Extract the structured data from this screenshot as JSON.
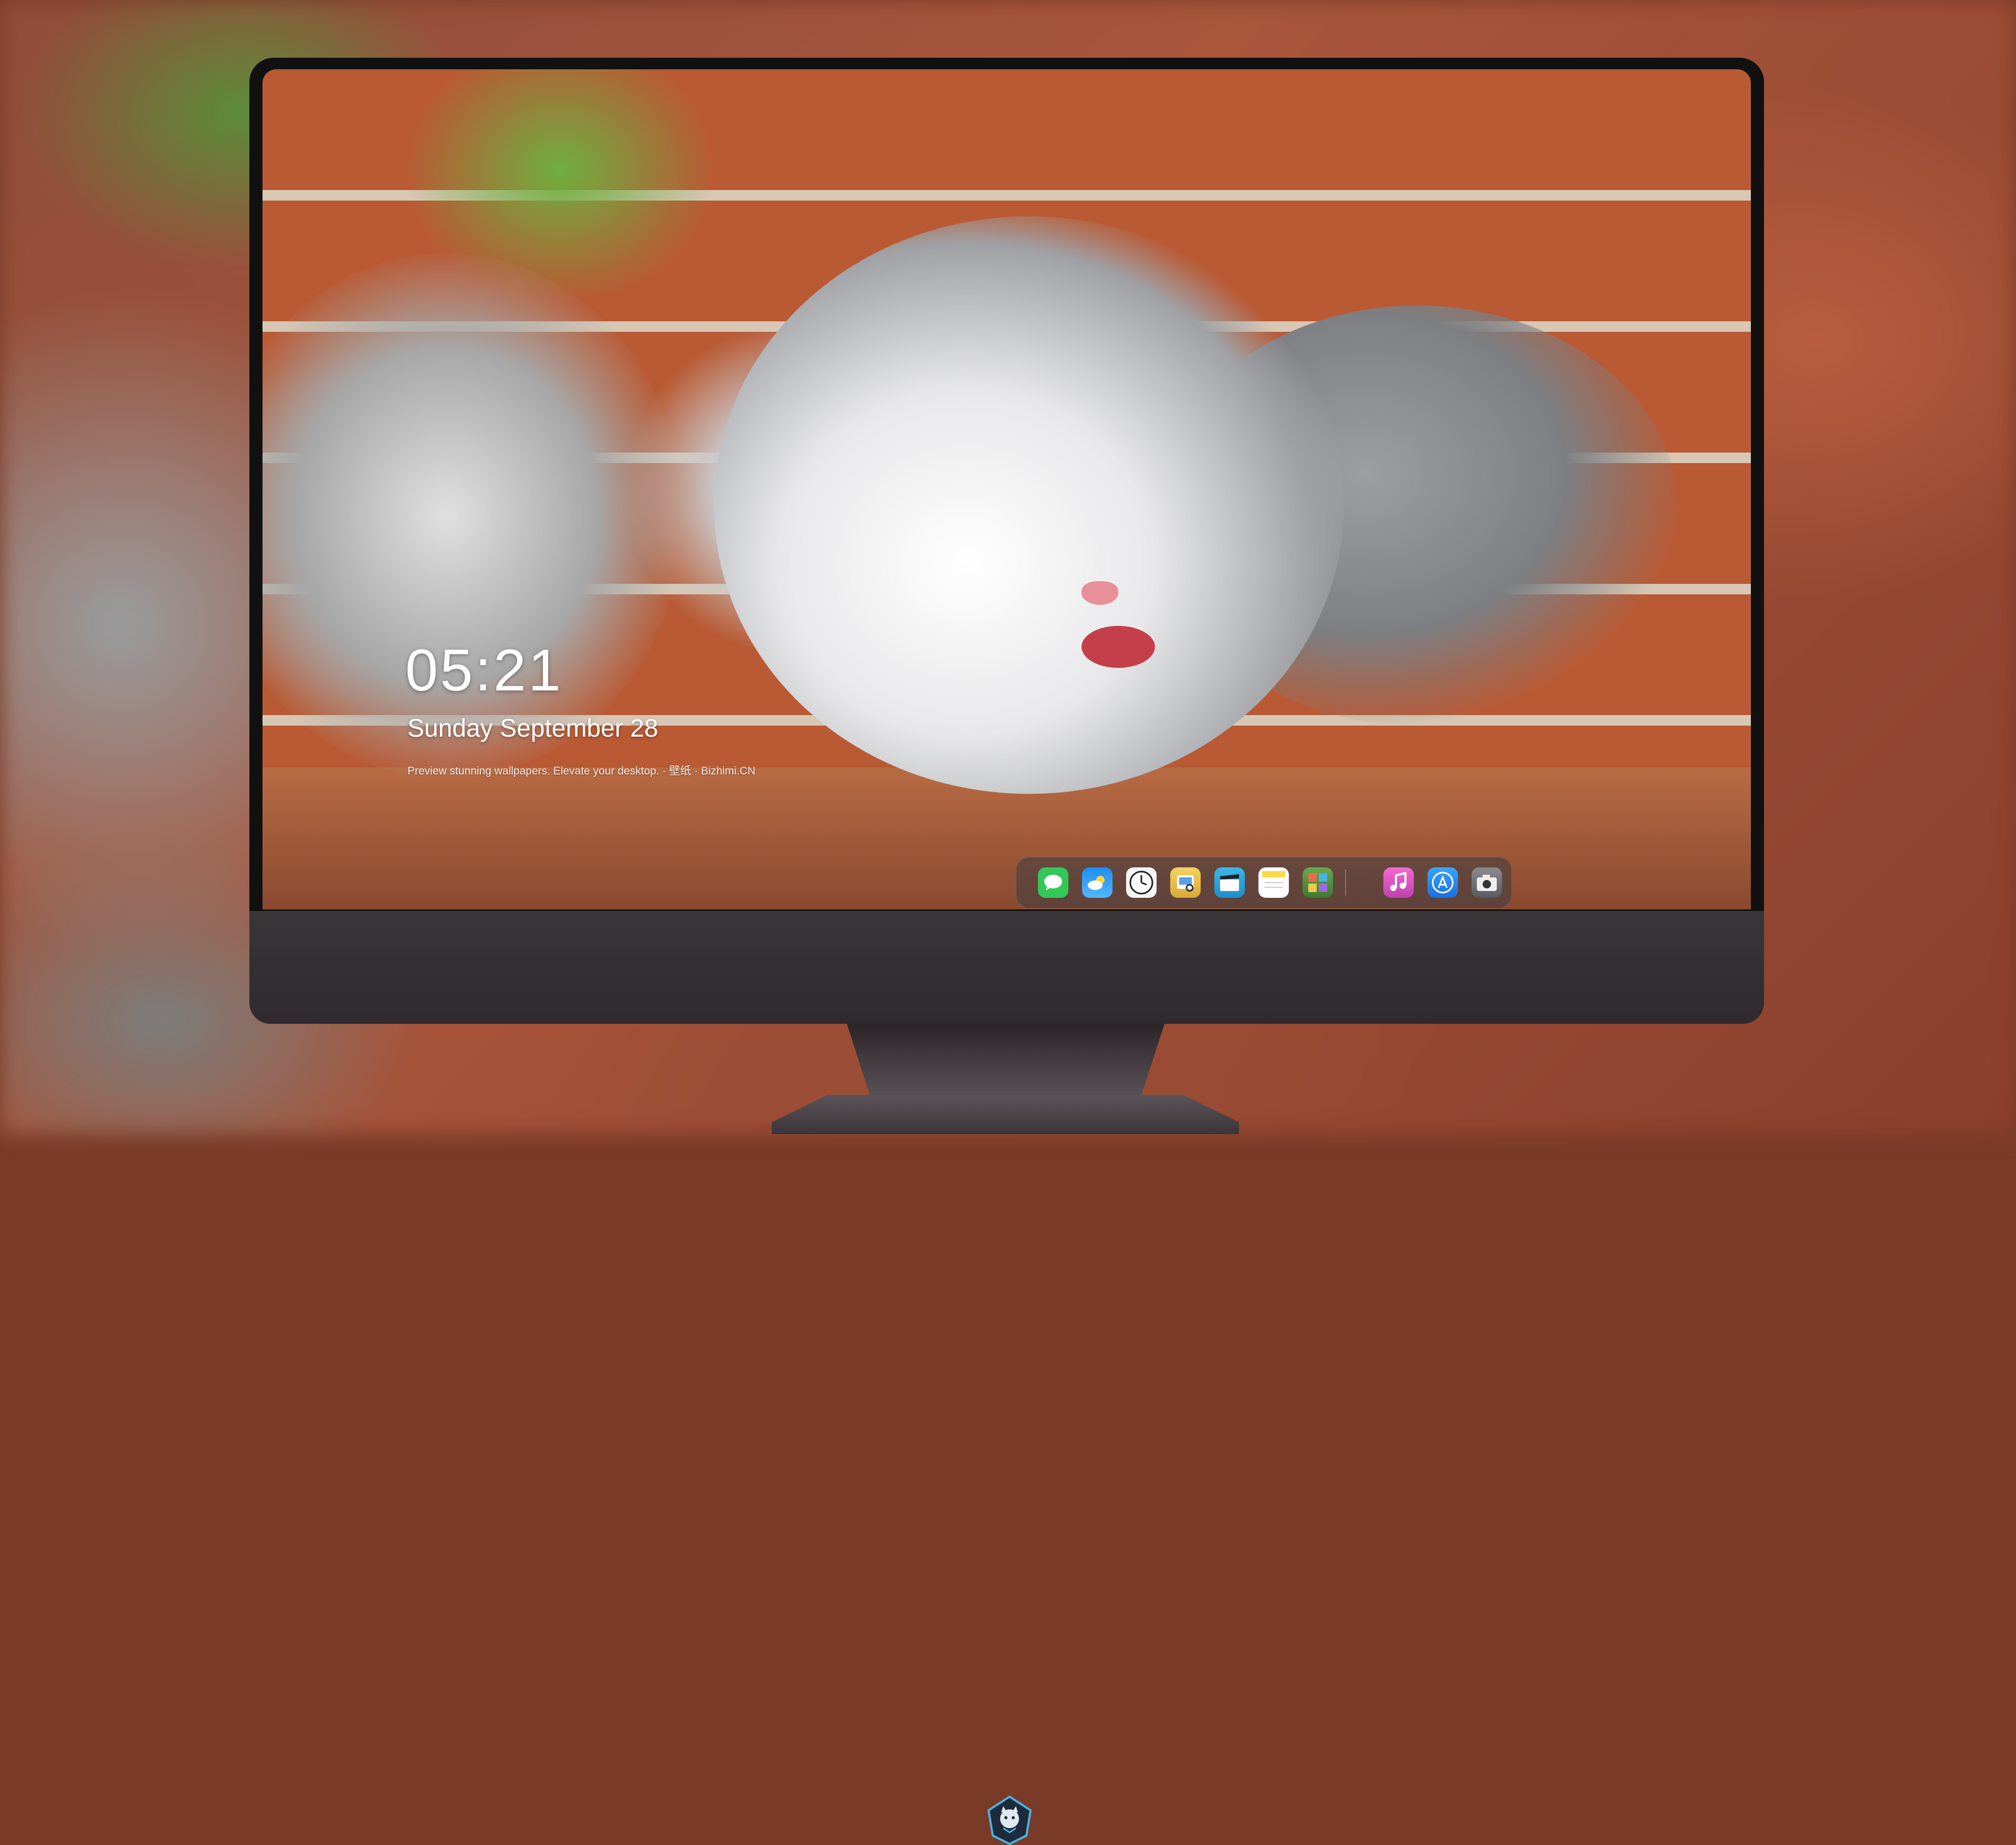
{
  "lockscreen": {
    "time": "05:21",
    "date": "Sunday September 28",
    "tagline": "Preview stunning wallpapers. Elevate your desktop. · 壁纸 · Bizhimi.CN"
  },
  "dock": {
    "apps": [
      {
        "name": "Messages",
        "icon": "message-bubble-icon",
        "color": "#34c759"
      },
      {
        "name": "Weather",
        "icon": "weather-cloud-icon",
        "color": "#1e8ef0"
      },
      {
        "name": "Clock",
        "icon": "clock-icon",
        "color": "#f5f5f5"
      },
      {
        "name": "Preview",
        "icon": "preview-icon",
        "color": "#e9c54a"
      },
      {
        "name": "Clips",
        "icon": "clapperboard-icon",
        "color": "#3ab8e6"
      },
      {
        "name": "Notes",
        "icon": "notes-icon",
        "color": "#fdd94a"
      },
      {
        "name": "Photo Booth",
        "icon": "photo-booth-icon",
        "color": "#6aa84f"
      },
      {
        "name": "Music",
        "icon": "music-note-icon",
        "color": "#e05cc6"
      },
      {
        "name": "App Store",
        "icon": "app-store-icon",
        "color": "#1a7ef2"
      },
      {
        "name": "Camera",
        "icon": "camera-icon",
        "color": "#6b6b70"
      }
    ]
  },
  "colors": {
    "bezel": "#111111",
    "chin": "#353035",
    "dock_bg": "rgba(60,60,66,0.55)"
  }
}
